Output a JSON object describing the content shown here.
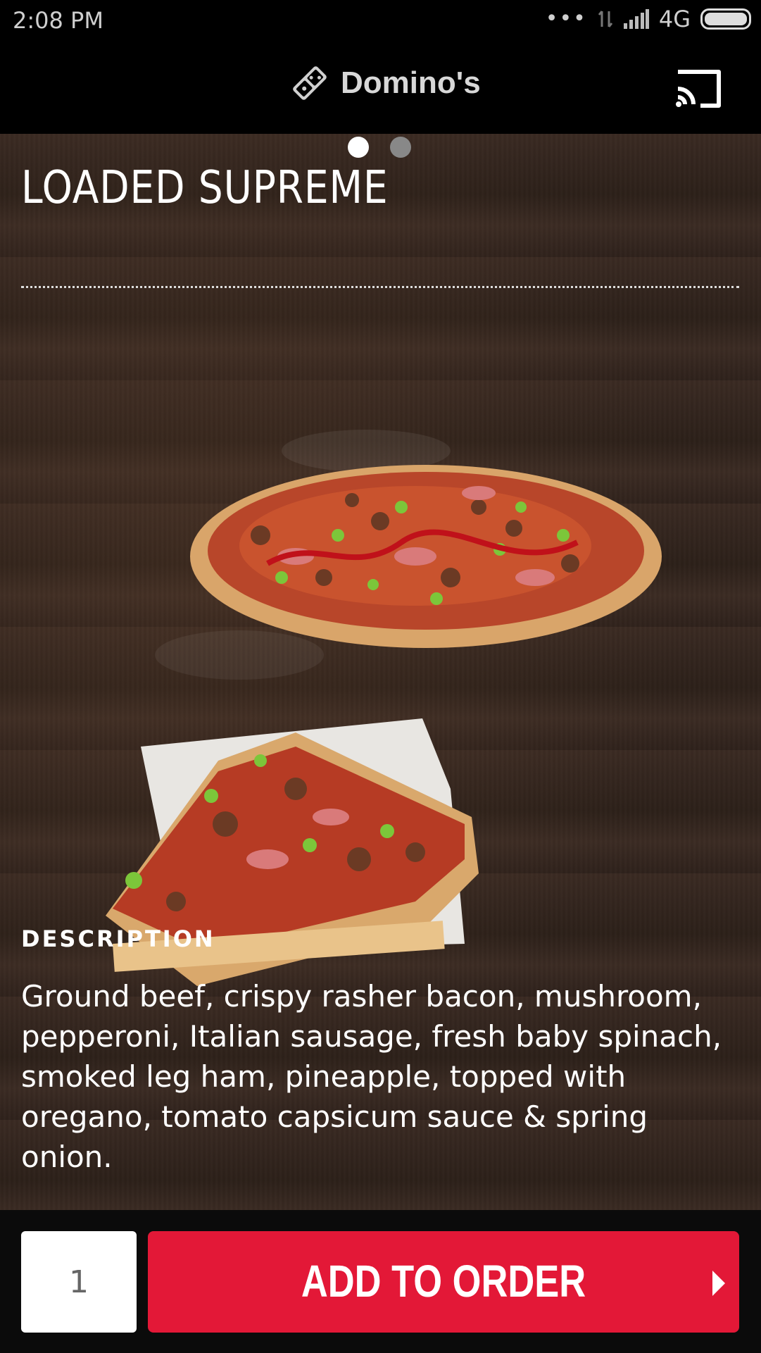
{
  "status_bar": {
    "time": "2:08  PM",
    "network": "4G"
  },
  "app_bar": {
    "brand": "Domino's"
  },
  "pager": {
    "count": 2,
    "active_index": 0
  },
  "product": {
    "title": "LOADED SUPREME",
    "description_heading": "DESCRIPTION",
    "description": "Ground beef, crispy rasher bacon, mushroom, pepperoni, Italian sausage, fresh baby spinach, smoked leg ham, pineapple, topped with oregano, tomato capsicum sauce & spring onion."
  },
  "order": {
    "quantity": "1",
    "add_label": "ADD TO ORDER"
  },
  "colors": {
    "accent": "#e31837",
    "wood": "#33251e"
  },
  "icons": [
    "more-dots-icon",
    "data-arrows-icon",
    "signal-icon",
    "battery-icon",
    "domino-logo-icon",
    "cast-icon",
    "chevron-right-icon"
  ]
}
